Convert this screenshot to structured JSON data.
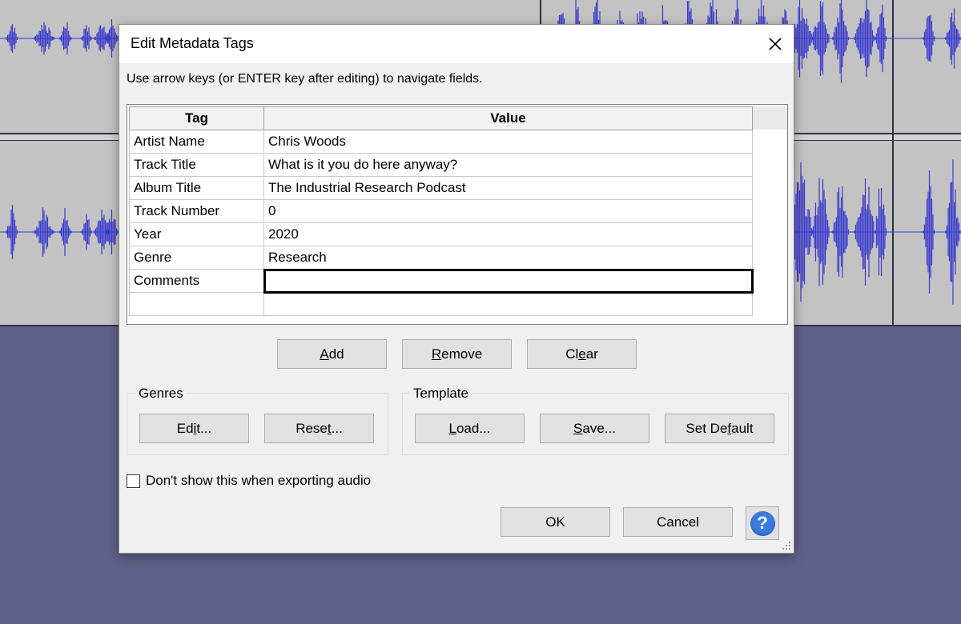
{
  "dialog": {
    "title": "Edit Metadata Tags",
    "instruction": "Use arrow keys (or ENTER key after editing) to navigate fields."
  },
  "table": {
    "headers": {
      "tag": "Tag",
      "value": "Value"
    },
    "rows": [
      {
        "tag": "Artist Name",
        "value": "Chris Woods"
      },
      {
        "tag": "Track Title",
        "value": "What is it you do here anyway?"
      },
      {
        "tag": "Album Title",
        "value": "The Industrial Research Podcast"
      },
      {
        "tag": "Track Number",
        "value": "0"
      },
      {
        "tag": "Year",
        "value": "2020"
      },
      {
        "tag": "Genre",
        "value": "Research"
      },
      {
        "tag": "Comments",
        "value": ""
      },
      {
        "tag": "",
        "value": ""
      }
    ]
  },
  "row_buttons": {
    "add": {
      "pre": "",
      "u": "A",
      "post": "dd"
    },
    "remove": {
      "pre": "",
      "u": "R",
      "post": "emove"
    },
    "clear": {
      "pre": "Cl",
      "u": "e",
      "post": "ar"
    }
  },
  "genres": {
    "label": "Genres",
    "edit": {
      "pre": "Ed",
      "u": "i",
      "post": "t..."
    },
    "reset": {
      "pre": "Rese",
      "u": "t",
      "post": "..."
    }
  },
  "template": {
    "label": "Template",
    "load": {
      "pre": "",
      "u": "L",
      "post": "oad..."
    },
    "save": {
      "pre": "",
      "u": "S",
      "post": "ave..."
    },
    "set_default": {
      "pre": "Set De",
      "u": "f",
      "post": "ault"
    }
  },
  "checkbox": {
    "label": "Don't show this when exporting audio",
    "checked": false
  },
  "footer": {
    "ok": "OK",
    "cancel": "Cancel",
    "help": "?"
  },
  "colors": {
    "waveform": "#3a3acd",
    "accent_help": "#3b7be0",
    "background": "#5f6189"
  },
  "icons": {
    "close": "close-icon",
    "help": "help-icon",
    "resize": "resize-grip-icon"
  }
}
